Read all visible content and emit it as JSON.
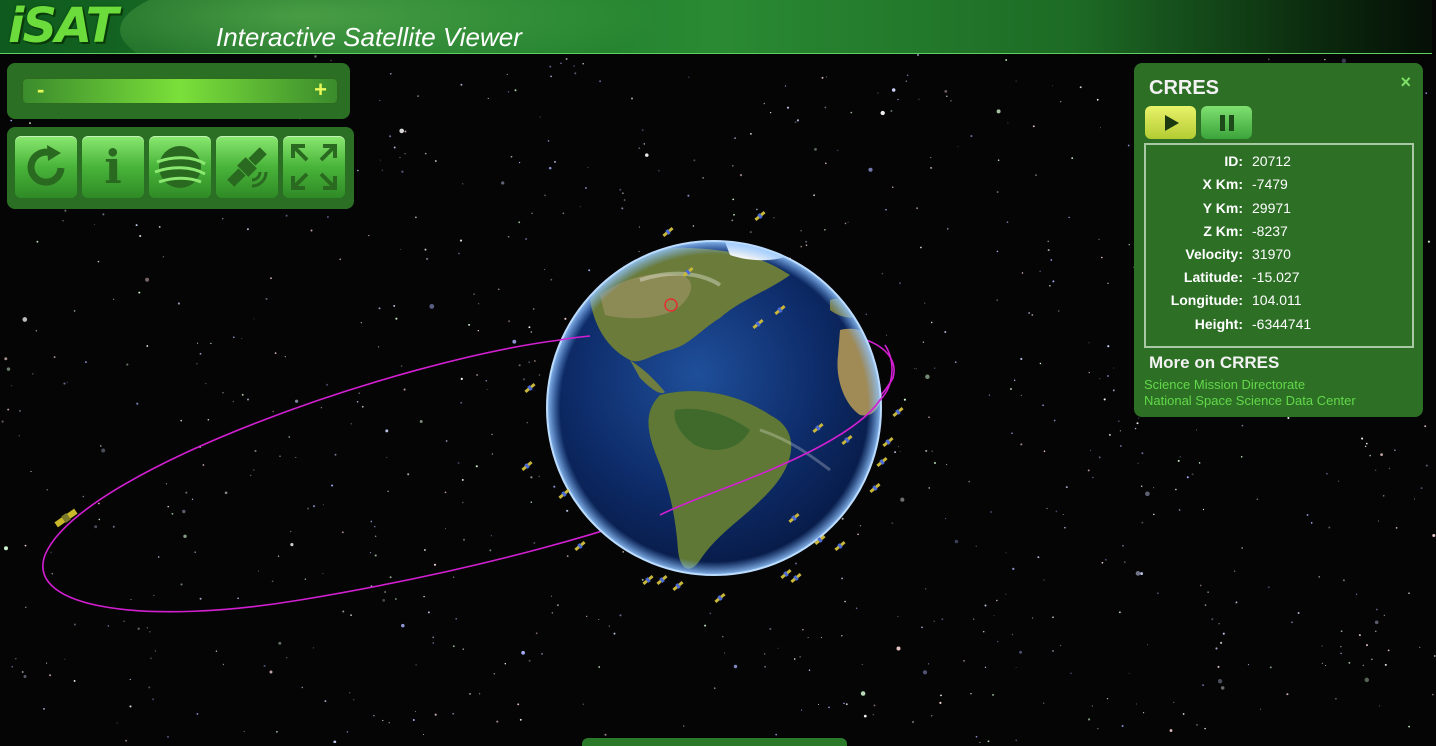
{
  "header": {
    "logo_text": "iSAT",
    "app_title": "Interactive Satellite Viewer"
  },
  "zoom": {
    "minus_label": "-",
    "plus_label": "+"
  },
  "toolbar": {
    "buttons": [
      {
        "name": "reset-view",
        "icon": "refresh-icon"
      },
      {
        "name": "info",
        "icon": "info-icon",
        "label": "i"
      },
      {
        "name": "globe",
        "icon": "globe-icon"
      },
      {
        "name": "satellite",
        "icon": "satellite-icon"
      },
      {
        "name": "fullscreen",
        "icon": "fullscreen-icon"
      }
    ]
  },
  "satellite_info": {
    "name": "CRRES",
    "close_label": "×",
    "stats": [
      {
        "label": "ID:",
        "value": "20712"
      },
      {
        "label": "X Km:",
        "value": "-7479"
      },
      {
        "label": "Y Km:",
        "value": "29971"
      },
      {
        "label": "Z Km:",
        "value": "-8237"
      },
      {
        "label": "Velocity:",
        "value": "31970"
      },
      {
        "label": "Latitude:",
        "value": "-15.027"
      },
      {
        "label": "Longitude:",
        "value": "104.011"
      },
      {
        "label": "Height:",
        "value": "-6344741"
      }
    ],
    "more_title": "More on CRRES",
    "links": [
      "Science Mission Directorate",
      "National Space Science Data Center"
    ]
  },
  "colors": {
    "panel_green": "#2c6f25",
    "orbit_magenta": "#d21fd2",
    "link_green": "#63d84a"
  }
}
